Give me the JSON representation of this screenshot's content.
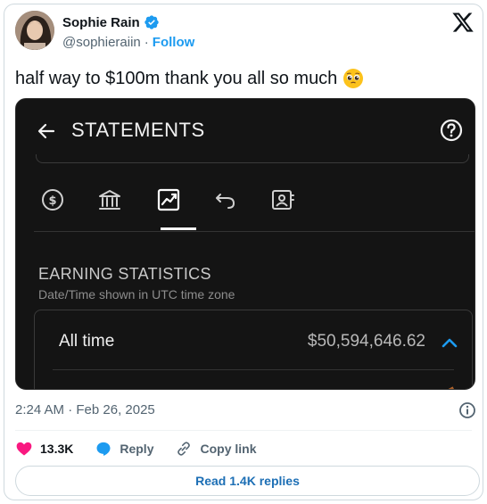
{
  "author": {
    "name": "Sophie Rain",
    "handle": "@sophieraiin",
    "separator": "·",
    "follow_label": "Follow"
  },
  "tweet": {
    "text": "half way to $100m thank you all so much",
    "emoji_icon": "pleading-face-icon"
  },
  "media": {
    "header_title": "STATEMENTS",
    "tab_icons": [
      "dollar-icon",
      "bank-icon",
      "chart-icon",
      "refund-icon",
      "profile-card-icon"
    ],
    "selected_tab": "chart-icon",
    "section_title": "EARNING STATISTICS",
    "section_subtitle": "Date/Time shown in UTC time zone",
    "period_label": "All time",
    "period_amount": "$50,594,646.62"
  },
  "meta": {
    "timestamp": "2:24 AM · Feb 26, 2025"
  },
  "actions": {
    "like_count": "13.3K",
    "reply_label": "Reply",
    "copy_label": "Copy link"
  },
  "read_replies_label": "Read 1.4K replies",
  "colors": {
    "accent": "#1d9bf0",
    "like": "#f91880",
    "media_bg": "#141414"
  }
}
